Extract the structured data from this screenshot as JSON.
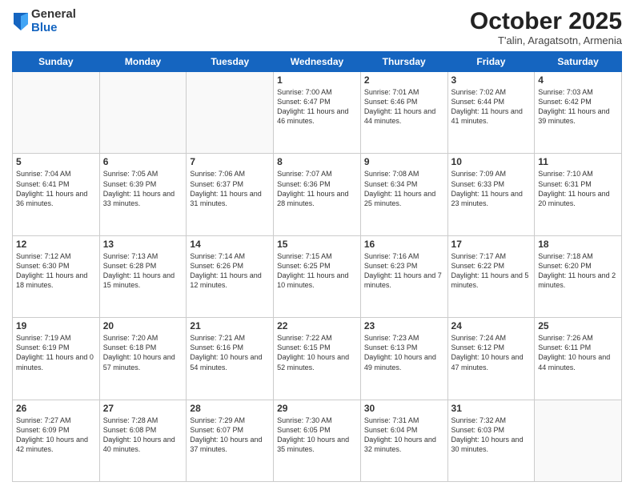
{
  "header": {
    "logo_general": "General",
    "logo_blue": "Blue",
    "month_title": "October 2025",
    "subtitle": "T'alin, Aragatsotn, Armenia"
  },
  "days_of_week": [
    "Sunday",
    "Monday",
    "Tuesday",
    "Wednesday",
    "Thursday",
    "Friday",
    "Saturday"
  ],
  "weeks": [
    [
      {
        "day": "",
        "text": ""
      },
      {
        "day": "",
        "text": ""
      },
      {
        "day": "",
        "text": ""
      },
      {
        "day": "1",
        "text": "Sunrise: 7:00 AM\nSunset: 6:47 PM\nDaylight: 11 hours and 46 minutes."
      },
      {
        "day": "2",
        "text": "Sunrise: 7:01 AM\nSunset: 6:46 PM\nDaylight: 11 hours and 44 minutes."
      },
      {
        "day": "3",
        "text": "Sunrise: 7:02 AM\nSunset: 6:44 PM\nDaylight: 11 hours and 41 minutes."
      },
      {
        "day": "4",
        "text": "Sunrise: 7:03 AM\nSunset: 6:42 PM\nDaylight: 11 hours and 39 minutes."
      }
    ],
    [
      {
        "day": "5",
        "text": "Sunrise: 7:04 AM\nSunset: 6:41 PM\nDaylight: 11 hours and 36 minutes."
      },
      {
        "day": "6",
        "text": "Sunrise: 7:05 AM\nSunset: 6:39 PM\nDaylight: 11 hours and 33 minutes."
      },
      {
        "day": "7",
        "text": "Sunrise: 7:06 AM\nSunset: 6:37 PM\nDaylight: 11 hours and 31 minutes."
      },
      {
        "day": "8",
        "text": "Sunrise: 7:07 AM\nSunset: 6:36 PM\nDaylight: 11 hours and 28 minutes."
      },
      {
        "day": "9",
        "text": "Sunrise: 7:08 AM\nSunset: 6:34 PM\nDaylight: 11 hours and 25 minutes."
      },
      {
        "day": "10",
        "text": "Sunrise: 7:09 AM\nSunset: 6:33 PM\nDaylight: 11 hours and 23 minutes."
      },
      {
        "day": "11",
        "text": "Sunrise: 7:10 AM\nSunset: 6:31 PM\nDaylight: 11 hours and 20 minutes."
      }
    ],
    [
      {
        "day": "12",
        "text": "Sunrise: 7:12 AM\nSunset: 6:30 PM\nDaylight: 11 hours and 18 minutes."
      },
      {
        "day": "13",
        "text": "Sunrise: 7:13 AM\nSunset: 6:28 PM\nDaylight: 11 hours and 15 minutes."
      },
      {
        "day": "14",
        "text": "Sunrise: 7:14 AM\nSunset: 6:26 PM\nDaylight: 11 hours and 12 minutes."
      },
      {
        "day": "15",
        "text": "Sunrise: 7:15 AM\nSunset: 6:25 PM\nDaylight: 11 hours and 10 minutes."
      },
      {
        "day": "16",
        "text": "Sunrise: 7:16 AM\nSunset: 6:23 PM\nDaylight: 11 hours and 7 minutes."
      },
      {
        "day": "17",
        "text": "Sunrise: 7:17 AM\nSunset: 6:22 PM\nDaylight: 11 hours and 5 minutes."
      },
      {
        "day": "18",
        "text": "Sunrise: 7:18 AM\nSunset: 6:20 PM\nDaylight: 11 hours and 2 minutes."
      }
    ],
    [
      {
        "day": "19",
        "text": "Sunrise: 7:19 AM\nSunset: 6:19 PM\nDaylight: 11 hours and 0 minutes."
      },
      {
        "day": "20",
        "text": "Sunrise: 7:20 AM\nSunset: 6:18 PM\nDaylight: 10 hours and 57 minutes."
      },
      {
        "day": "21",
        "text": "Sunrise: 7:21 AM\nSunset: 6:16 PM\nDaylight: 10 hours and 54 minutes."
      },
      {
        "day": "22",
        "text": "Sunrise: 7:22 AM\nSunset: 6:15 PM\nDaylight: 10 hours and 52 minutes."
      },
      {
        "day": "23",
        "text": "Sunrise: 7:23 AM\nSunset: 6:13 PM\nDaylight: 10 hours and 49 minutes."
      },
      {
        "day": "24",
        "text": "Sunrise: 7:24 AM\nSunset: 6:12 PM\nDaylight: 10 hours and 47 minutes."
      },
      {
        "day": "25",
        "text": "Sunrise: 7:26 AM\nSunset: 6:11 PM\nDaylight: 10 hours and 44 minutes."
      }
    ],
    [
      {
        "day": "26",
        "text": "Sunrise: 7:27 AM\nSunset: 6:09 PM\nDaylight: 10 hours and 42 minutes."
      },
      {
        "day": "27",
        "text": "Sunrise: 7:28 AM\nSunset: 6:08 PM\nDaylight: 10 hours and 40 minutes."
      },
      {
        "day": "28",
        "text": "Sunrise: 7:29 AM\nSunset: 6:07 PM\nDaylight: 10 hours and 37 minutes."
      },
      {
        "day": "29",
        "text": "Sunrise: 7:30 AM\nSunset: 6:05 PM\nDaylight: 10 hours and 35 minutes."
      },
      {
        "day": "30",
        "text": "Sunrise: 7:31 AM\nSunset: 6:04 PM\nDaylight: 10 hours and 32 minutes."
      },
      {
        "day": "31",
        "text": "Sunrise: 7:32 AM\nSunset: 6:03 PM\nDaylight: 10 hours and 30 minutes."
      },
      {
        "day": "",
        "text": ""
      }
    ]
  ]
}
